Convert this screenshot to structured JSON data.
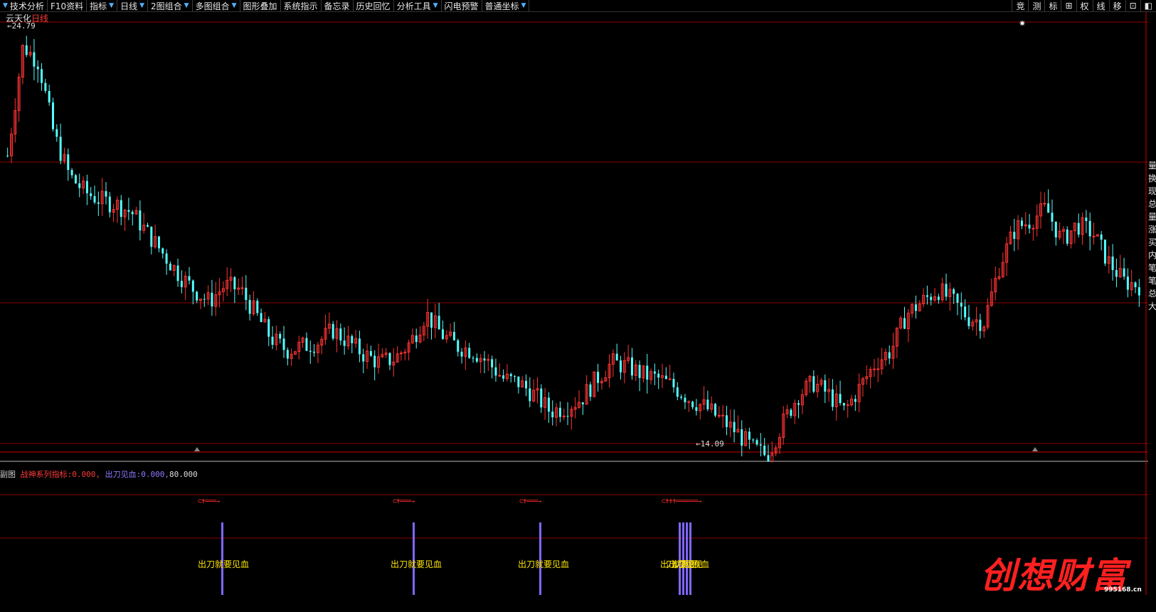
{
  "toolbar": {
    "left_items": [
      {
        "label": "技术分析",
        "arrow": true,
        "lead": true
      },
      {
        "label": "F10资料",
        "arrow": false,
        "lead": false
      },
      {
        "label": "指标",
        "arrow": true,
        "lead": false
      },
      {
        "label": "日线",
        "arrow": true,
        "lead": false
      },
      {
        "label": "2图组合",
        "arrow": true,
        "lead": false
      },
      {
        "label": "多图组合",
        "arrow": true,
        "lead": false
      },
      {
        "label": "图形叠加",
        "arrow": false,
        "lead": false
      },
      {
        "label": "系统指示",
        "arrow": false,
        "lead": false
      },
      {
        "label": "备忘录",
        "arrow": false,
        "lead": false
      },
      {
        "label": "历史回忆",
        "arrow": false,
        "lead": false
      },
      {
        "label": "分析工具",
        "arrow": true,
        "lead": false
      },
      {
        "label": "闪电预警",
        "arrow": false,
        "lead": false
      },
      {
        "label": "普通坐标",
        "arrow": true,
        "lead": false
      }
    ],
    "right_items": [
      "竞",
      "测",
      "标",
      "⊞",
      "权",
      "线",
      "移",
      "⊡",
      "◧"
    ]
  },
  "stock": {
    "name": "云天化",
    "period": "日线"
  },
  "price_markers": {
    "high": "24.79",
    "low": "14.09"
  },
  "sub_chart": {
    "name": "副图",
    "indicator_label": "战神系列指标:",
    "indicator_value": "0.000,",
    "signal_label": "出刀见血:",
    "signal_value": "0.000,",
    "level": "80.000",
    "signal_text": "出刀就要见血"
  },
  "right_strip": [
    "量",
    "换",
    "现",
    "总",
    "量",
    "涨",
    "买",
    "内",
    "笔",
    "笔",
    "总",
    "大"
  ],
  "watermark": {
    "text": "创想财富",
    "url": "995168.cn"
  },
  "colors": {
    "up": "#ff3333",
    "down": "#54ffff",
    "signal_bar": "#8066ff",
    "signal_text": "#ffe600",
    "grid": "#8b0000"
  },
  "chart_data": {
    "type": "candlestick",
    "high": 24.79,
    "low": 14.09,
    "close_path": [
      21.5,
      24.2,
      23.8,
      22.0,
      21.0,
      20.6,
      20.4,
      20.3,
      20.1,
      19.6,
      19.1,
      18.6,
      18.2,
      17.9,
      18.3,
      18.2,
      17.6,
      17.0,
      16.7,
      16.8,
      16.9,
      17.2,
      16.9,
      16.6,
      16.4,
      16.5,
      16.9,
      17.6,
      17.1,
      16.8,
      16.7,
      16.4,
      16.0,
      15.9,
      15.6,
      15.2,
      15.3,
      15.5,
      16.0,
      16.4,
      16.3,
      16.1,
      16.0,
      15.8,
      15.5,
      15.3,
      15.0,
      14.7,
      14.3,
      14.1,
      14.9,
      15.6,
      15.9,
      15.6,
      15.2,
      15.8,
      16.4,
      16.7,
      17.6,
      17.9,
      18.2,
      17.9,
      17.5,
      17.4,
      18.8,
      19.7,
      19.9,
      20.2,
      19.4,
      19.8,
      19.6,
      18.9,
      18.4,
      18.3
    ]
  }
}
